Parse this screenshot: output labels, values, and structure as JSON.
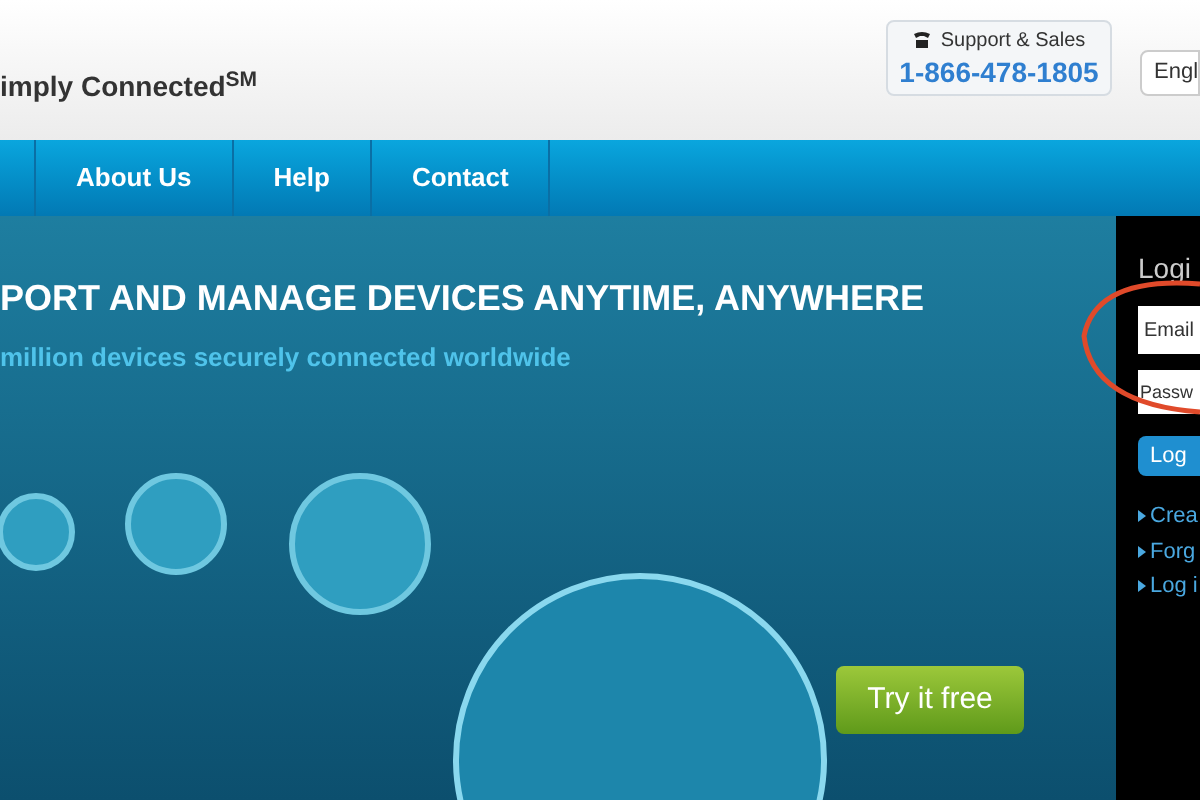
{
  "header": {
    "logo_text": "imply Connected$^{SM}$",
    "support": {
      "label": "Support & Sales",
      "phone": "1-866-478-1805"
    },
    "language": "Engl"
  },
  "nav": {
    "items": [
      {
        "label": "About Us"
      },
      {
        "label": "Help"
      },
      {
        "label": "Contact"
      }
    ]
  },
  "hero": {
    "title": "PORT AND MANAGE DEVICES ANYTIME, ANYWHERE",
    "subtitle": "million devices securely connected worldwide",
    "cta": "Try it free"
  },
  "login": {
    "title": "Logi",
    "email": {
      "placeholder": "Email"
    },
    "password": {
      "placeholder": "Passw"
    },
    "button": "Log",
    "links": [
      {
        "label": "Crea"
      },
      {
        "label": "Forg"
      },
      {
        "label": "Log i"
      }
    ]
  }
}
